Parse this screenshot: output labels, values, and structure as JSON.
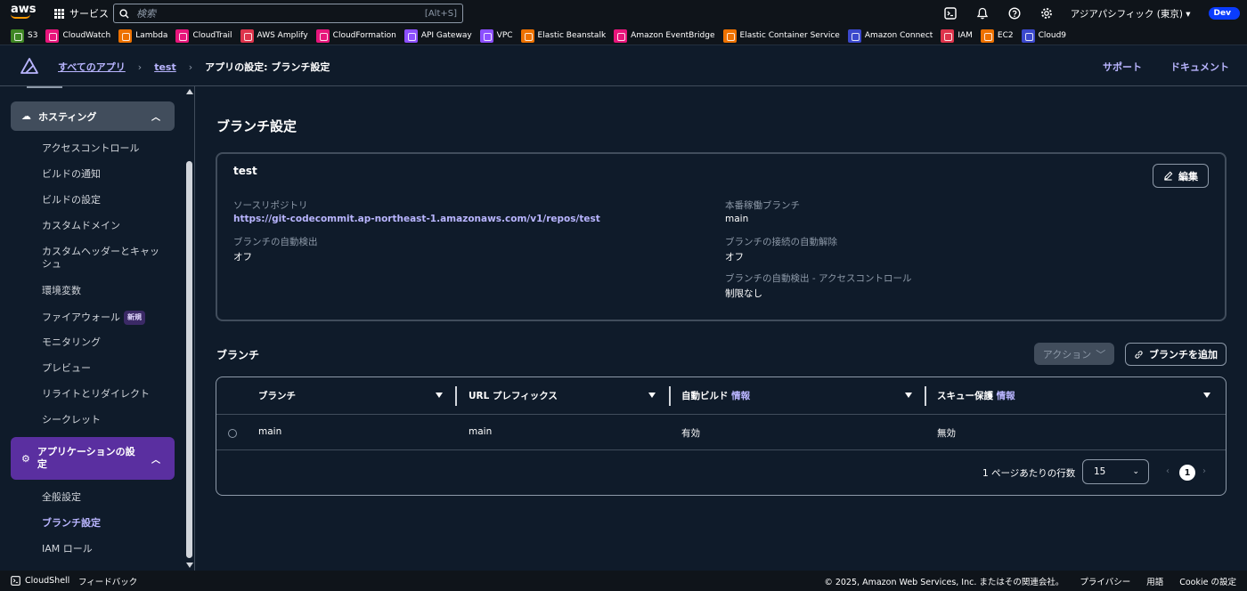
{
  "topbar": {
    "logo": "aws",
    "services_label": "サービス",
    "search_placeholder": "検索",
    "search_shortcut": "[Alt+S]",
    "region": "アジアパシフィック (東京)",
    "account_badge": "Dev",
    "icons": [
      "cloudshell-icon",
      "bell-icon",
      "help-icon",
      "gear-icon"
    ]
  },
  "favorites": [
    {
      "label": "S3",
      "color": "#3f8624"
    },
    {
      "label": "CloudWatch",
      "color": "#e7157b"
    },
    {
      "label": "Lambda",
      "color": "#ed7100"
    },
    {
      "label": "CloudTrail",
      "color": "#e7157b"
    },
    {
      "label": "AWS Amplify",
      "color": "#dd344c"
    },
    {
      "label": "CloudFormation",
      "color": "#e7157b"
    },
    {
      "label": "API Gateway",
      "color": "#8c4fff"
    },
    {
      "label": "VPC",
      "color": "#8c4fff"
    },
    {
      "label": "Elastic Beanstalk",
      "color": "#ed7100"
    },
    {
      "label": "Amazon EventBridge",
      "color": "#e7157b"
    },
    {
      "label": "Elastic Container Service",
      "color": "#ed7100"
    },
    {
      "label": "Amazon Connect",
      "color": "#3b48cc"
    },
    {
      "label": "IAM",
      "color": "#dd344c"
    },
    {
      "label": "EC2",
      "color": "#ed7100"
    },
    {
      "label": "Cloud9",
      "color": "#3b48cc"
    }
  ],
  "header": {
    "breadcrumb": {
      "all_apps": "すべてのアプリ",
      "app": "test",
      "current": "アプリの設定: ブランチ設定"
    },
    "support": "サポート",
    "docs": "ドキュメント"
  },
  "sidebar": {
    "hosting_group": "ホスティング",
    "hosting_items": [
      "アクセスコントロール",
      "ビルドの通知",
      "ビルドの設定",
      "カスタムドメイン",
      "カスタムヘッダーとキャッシュ",
      "環境変数",
      "ファイアウォール",
      "モニタリング",
      "プレビュー",
      "リライトとリダイレクト",
      "シークレット"
    ],
    "new_badge": "新規",
    "app_settings_group": "アプリケーションの設定",
    "app_settings_items": [
      "全般設定",
      "ブランチ設定",
      "IAM ロール"
    ]
  },
  "main": {
    "title": "ブランチ設定",
    "card": {
      "name": "test",
      "edit_button": "編集",
      "source_repo_label": "ソースリポジトリ",
      "source_repo_value": "https://git-codecommit.ap-northeast-1.amazonaws.com/v1/repos/test",
      "auto_detect_label": "ブランチの自動検出",
      "auto_detect_value": "オフ",
      "prod_branch_label": "本番稼働ブランチ",
      "prod_branch_value": "main",
      "auto_disconnect_label": "ブランチの接続の自動解除",
      "auto_disconnect_value": "オフ",
      "auto_detect_access_label": "ブランチの自動検出 - アクセスコントロール",
      "auto_detect_access_value": "制限なし"
    },
    "branches": {
      "title": "ブランチ",
      "actions_button": "アクション",
      "add_button": "ブランチを追加",
      "columns": {
        "branch": "ブランチ",
        "url_prefix": "URL プレフィックス",
        "auto_build": "自動ビルド",
        "skew": "スキュー保護",
        "info": "情報"
      },
      "rows": [
        {
          "branch": "main",
          "url_prefix": "main",
          "auto_build": "有効",
          "skew": "無効"
        }
      ],
      "rows_per_page_label": "1 ページあたりの行数",
      "rows_per_page_value": "15",
      "current_page": "1"
    }
  },
  "footer": {
    "cloudshell": "CloudShell",
    "feedback": "フィードバック",
    "copyright": "© 2025, Amazon Web Services, Inc. またはその関連会社。",
    "privacy": "プライバシー",
    "terms": "用語",
    "cookie": "Cookie の設定"
  }
}
